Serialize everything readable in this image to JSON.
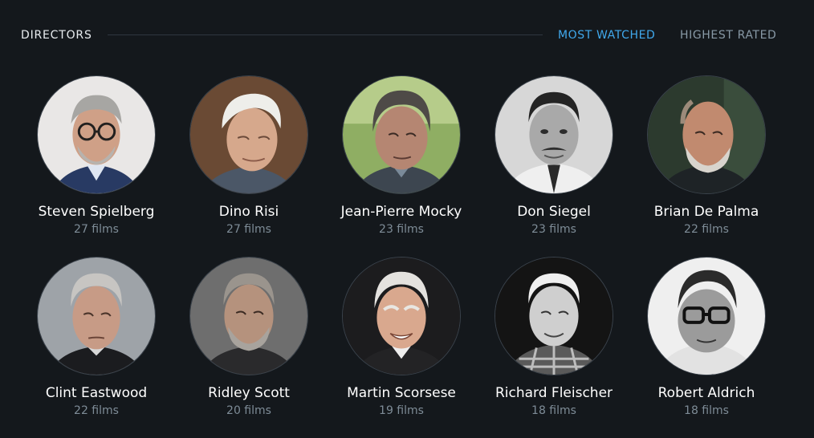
{
  "section": {
    "title": "DIRECTORS",
    "tabs": [
      {
        "label": "MOST WATCHED",
        "active": true,
        "color": "#40a8ec"
      },
      {
        "label": "HIGHEST RATED",
        "active": false,
        "color": "#8899a6"
      }
    ]
  },
  "directors": [
    {
      "name": "Steven Spielberg",
      "films": "27 films"
    },
    {
      "name": "Dino Risi",
      "films": "27 films"
    },
    {
      "name": "Jean-Pierre Mocky",
      "films": "23 films"
    },
    {
      "name": "Don Siegel",
      "films": "23 films"
    },
    {
      "name": "Brian De Palma",
      "films": "22 films"
    },
    {
      "name": "Clint Eastwood",
      "films": "22 films"
    },
    {
      "name": "Ridley Scott",
      "films": "20 films"
    },
    {
      "name": "Martin Scorsese",
      "films": "19 films"
    },
    {
      "name": "Richard Fleischer",
      "films": "18 films"
    },
    {
      "name": "Robert Aldrich",
      "films": "18 films"
    }
  ],
  "colors": {
    "background": "#14181c",
    "accent": "#40a8ec",
    "muted": "#7e8c97"
  }
}
